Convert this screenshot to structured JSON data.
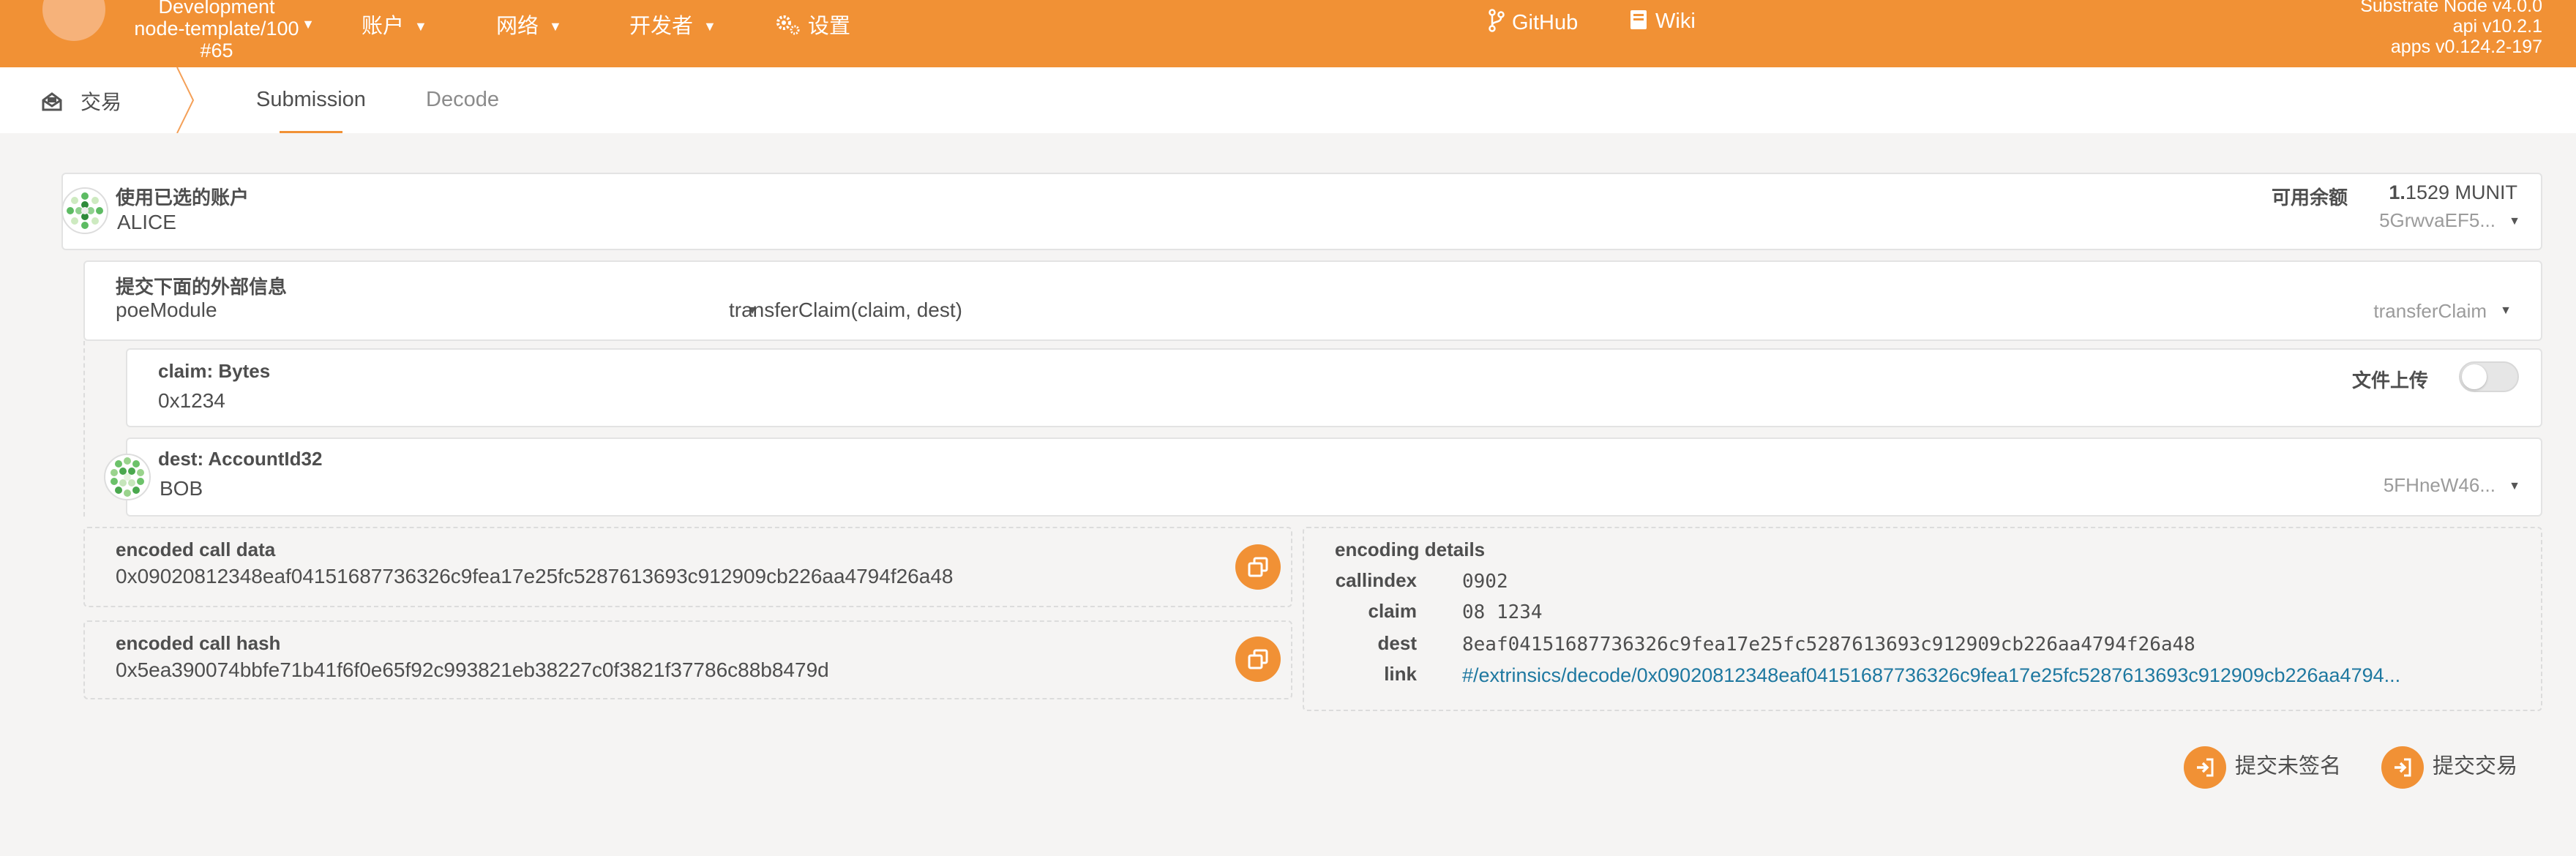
{
  "topbar": {
    "chain": {
      "line1": "Development",
      "line2": "node-template/100",
      "line3": "#65"
    },
    "menu": [
      {
        "label": "账户",
        "icon": "caret-down-icon"
      },
      {
        "label": "网络",
        "icon": "caret-down-icon"
      },
      {
        "label": "开发者",
        "icon": "caret-down-icon"
      },
      {
        "label": "设置",
        "icon": "gears-icon"
      }
    ],
    "links": [
      {
        "label": "GitHub",
        "icon": "code-branch-icon"
      },
      {
        "label": "Wiki",
        "icon": "book-icon"
      }
    ],
    "version": {
      "line1": "Substrate Node v4.0.0",
      "line2": "api v10.2.1",
      "line3": "apps v0.124.2-197"
    }
  },
  "tabbar": {
    "section": "交易",
    "tabs": [
      {
        "label": "Submission",
        "active": true
      },
      {
        "label": "Decode",
        "active": false
      }
    ]
  },
  "account": {
    "label": "使用已选的账户",
    "name": "ALICE",
    "balance_label": "可用余额",
    "balance_int": "1.",
    "balance_frac": "1529 MUNIT",
    "address": "5GrwvaEF5..."
  },
  "extrinsic": {
    "label": "提交下面的外部信息",
    "module": "poeModule",
    "call": "transferClaim(claim, dest)",
    "call_select": "transferClaim"
  },
  "params": {
    "claim": {
      "label": "claim: Bytes",
      "value": "0x1234",
      "upload_label": "文件上传"
    },
    "dest": {
      "label": "dest: AccountId32",
      "name": "BOB",
      "address": "5FHneW46..."
    }
  },
  "encoded": {
    "call_data_label": "encoded call data",
    "call_data": "0x09020812348eaf04151687736326c9fea17e25fc5287613693c912909cb226aa4794f26a48",
    "call_hash_label": "encoded call hash",
    "call_hash": "0x5ea390074bbfe71b41f6f0e65f92c993821eb38227c0f3821f37786c88b8479d"
  },
  "details": {
    "title": "encoding details",
    "callindex_key": "callindex",
    "callindex": "0902",
    "claim_key": "claim",
    "claim": "08 1234",
    "dest_key": "dest",
    "dest": "8eaf04151687736326c9fea17e25fc5287613693c912909cb226aa4794f26a48",
    "link_key": "link",
    "link": "#/extrinsics/decode/0x09020812348eaf04151687736326c9fea17e25fc5287613693c912909cb226aa4794..."
  },
  "actions": {
    "unsigned": "提交未签名",
    "submit": "提交交易"
  },
  "colors": {
    "accent": "#f19135",
    "link": "#1e78a0"
  }
}
